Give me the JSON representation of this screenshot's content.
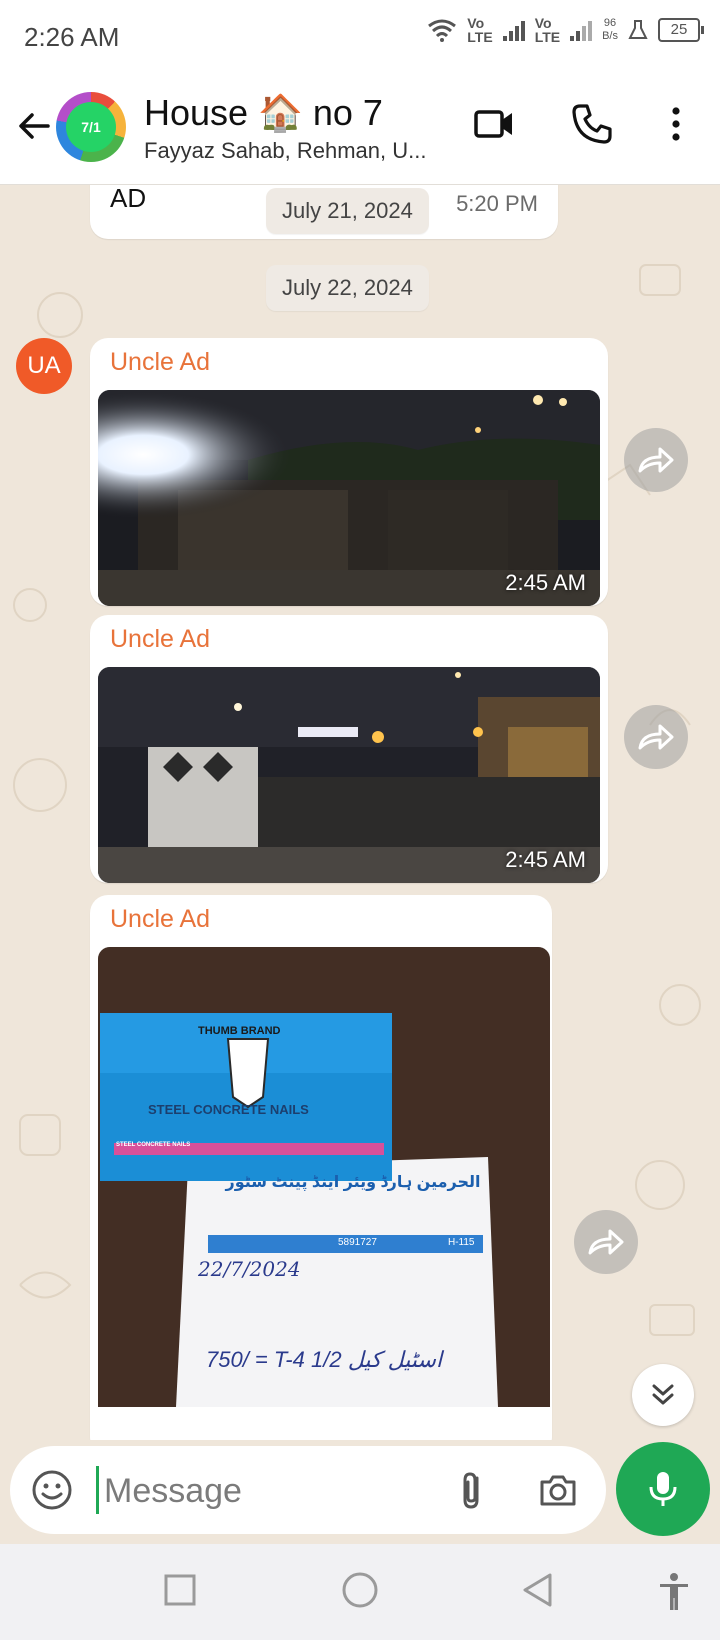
{
  "status_bar": {
    "time": "2:26 AM",
    "lte1": [
      "Vo",
      "LTE"
    ],
    "lte2": [
      "Vo",
      "LTE"
    ],
    "speed_value": "96",
    "speed_unit": "B/s",
    "battery": "25"
  },
  "header": {
    "group_avatar_text": "7/1",
    "title": "House 🏠 no 7",
    "subtitle": "Fayyaz Sahab, Rehman, U..."
  },
  "chat": {
    "previous_message": {
      "text": "AD",
      "time": "5:20 PM"
    },
    "date_separators": [
      "July 21, 2024",
      "July 22, 2024"
    ],
    "sender_avatar": "UA",
    "messages": [
      {
        "sender": "Uncle Ad",
        "type": "image",
        "time": "2:45 AM",
        "image": "night-construction-site-1"
      },
      {
        "sender": "Uncle Ad",
        "type": "image",
        "time": "2:45 AM",
        "image": "night-construction-site-2"
      },
      {
        "sender": "Uncle Ad",
        "type": "image",
        "time": "",
        "image": "steel-nails-box-and-receipt"
      }
    ],
    "nails_box": {
      "brand": "THUMB BRAND",
      "label": "STEEL CONCRETE NAILS",
      "stripe": "STEEL CONCRETE NAILS"
    },
    "receipt": {
      "shop": "الحرمین ہارڈ ویئر اینڈ پینٹ سٹور",
      "phone": "5891727",
      "code": "H-115",
      "date": "22/7/2024",
      "line": "750/ = T-4 اسٹیل کیل 1/2"
    }
  },
  "composer": {
    "placeholder": "Message"
  },
  "icons": {
    "back": "arrow-left-icon",
    "video": "video-camera-icon",
    "call": "phone-icon",
    "menu": "more-vert-icon",
    "emoji": "emoji-icon",
    "attach": "paperclip-icon",
    "camera": "camera-icon",
    "mic": "microphone-icon",
    "forward": "forward-icon",
    "scroll": "double-chevron-down-icon"
  },
  "colors": {
    "accent": "#1fa855",
    "sender": "#e8733a",
    "avatar": "#f05a28",
    "chat_bg": "#efe6da"
  }
}
